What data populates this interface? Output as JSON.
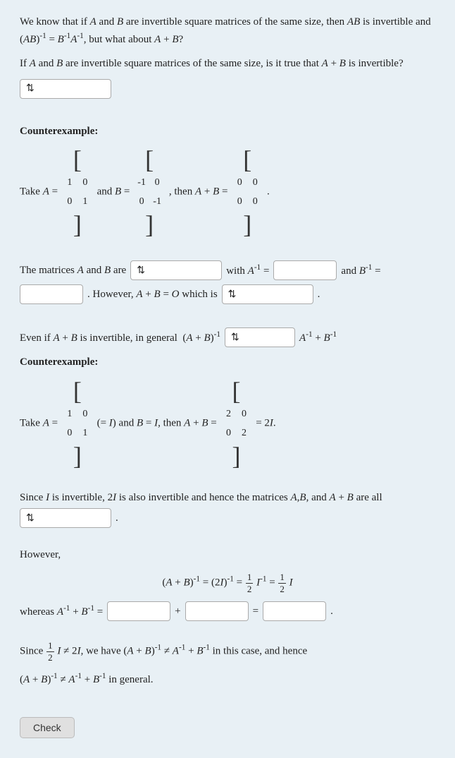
{
  "intro": {
    "line1": "We know that if A and B are invertible square matrices of the same size, then AB is",
    "line2": "invertible and (AB)⁻¹ = B⁻¹A⁻¹, but what about A + B?",
    "question": "If A and B are invertible square matrices of the same size, is it true that A + B is invertible?"
  },
  "dropdown1": {
    "placeholder": "÷",
    "label": "first-dropdown"
  },
  "counterexample1": {
    "label": "Counterexample:",
    "take_text": "Take A =",
    "and_b_text": "and B =",
    "then_text": "then A + B =",
    "matrix_A": [
      [
        "1",
        "0"
      ],
      [
        "0",
        "1"
      ]
    ],
    "matrix_B": [
      [
        "-1",
        "0"
      ],
      [
        "0",
        "-1"
      ]
    ],
    "matrix_AB": [
      [
        "0",
        "0"
      ],
      [
        "0",
        "0"
      ]
    ]
  },
  "matrices_line": {
    "text1": "The matrices A and B are",
    "text2": "with A⁻¹ =",
    "text3": "and B⁻¹ =",
    "text4": ". However, A + B = O which is"
  },
  "dropdown2": {
    "placeholder": "÷",
    "label": "invertible-dropdown"
  },
  "dropdown3": {
    "placeholder": "÷",
    "label": "zero-matrix-dropdown"
  },
  "even_if": {
    "text": "Even if A + B is invertible, in general  (A + B)⁻¹",
    "symbol_text": "A⁻¹ + B⁻¹"
  },
  "dropdown4": {
    "placeholder": "÷",
    "label": "comparison-dropdown"
  },
  "counterexample2": {
    "label": "Counterexample:",
    "take_text": "Take A =",
    "eq_i": "(= I) and B = I, then A + B =",
    "eq_2i": "= 2I.",
    "matrix_A": [
      [
        "1",
        "0"
      ],
      [
        "0",
        "1"
      ]
    ],
    "matrix_sum": [
      [
        "2",
        "0"
      ],
      [
        "0",
        "2"
      ]
    ]
  },
  "since_line": {
    "text": "Since I is invertible, 2I is also invertible and hence the matrices A,B, and A + B are all"
  },
  "dropdown5": {
    "placeholder": "÷",
    "label": "all-invertible-dropdown"
  },
  "however": {
    "label": "However,",
    "formula": "(A + B)⁻¹ = (2I)⁻¹ = ½I⁻¹ = ½I"
  },
  "whereas_line": {
    "text": "whereas A⁻¹ + B⁻¹ =",
    "plus": "+",
    "equals": "="
  },
  "since_final": {
    "line1": "Since ½I ≠ 2I, we have (A + B)⁻¹ ≠ A⁻¹ + B⁻¹ in this case, and hence",
    "line2": "(A + B)⁻¹ ≠ A⁻¹ + B⁻¹ in general."
  },
  "check_button": "Check"
}
